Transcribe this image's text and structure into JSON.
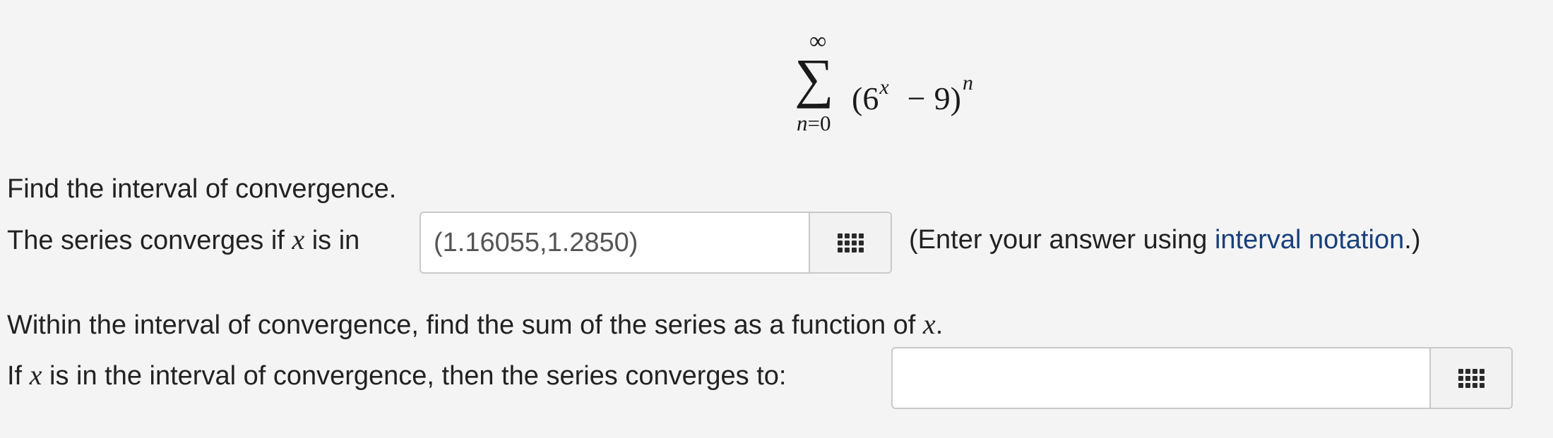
{
  "formula": {
    "sigma": "∑",
    "upper_limit": "∞",
    "lower_var": "n",
    "lower_eq": "=0",
    "open": "(6",
    "exp_x": "x",
    "minus": "−",
    "close": "9)",
    "exp_n": "n"
  },
  "q1": {
    "prompt": "Find the interval of convergence.",
    "label_before": "The series converges if ",
    "var": "x",
    "label_after": " is in",
    "answer_value": "(1.16055,1.2850)",
    "hint_before": "(Enter your answer using ",
    "hint_link": "interval notation",
    "hint_after": ".)"
  },
  "q2": {
    "prompt_before": "Within the interval of convergence, find the sum of the series as a function of ",
    "prompt_var": "x",
    "prompt_after": ".",
    "label_before": "If ",
    "var": "x",
    "label_after": " is in the interval of convergence, then the series converges to:",
    "answer_value": ""
  },
  "icons": {
    "keypad": "keypad-grid-icon"
  }
}
